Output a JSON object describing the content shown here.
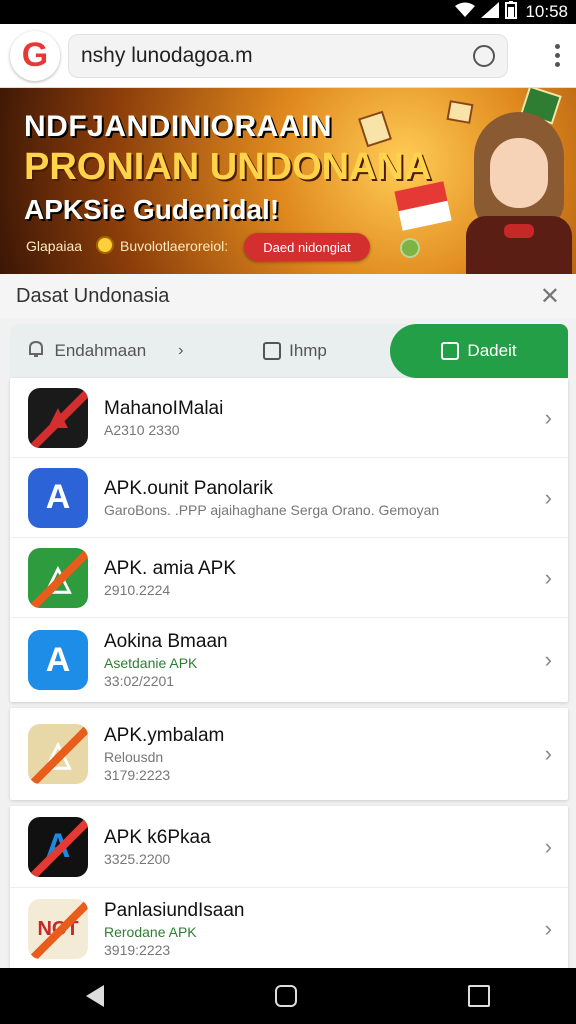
{
  "status_bar": {
    "time": "10:58"
  },
  "url_bar": {
    "logo": "G",
    "url": "nshy lunodagoa.m"
  },
  "banner": {
    "line1": "NDFJANDINIORAAIN",
    "line2": "PRONIAN UNDONANA",
    "line3": "APKSie Gudenidal!",
    "small_left": "Glapaiaa",
    "small_mid": "Buvolotlaeroreiol:",
    "cta_label": "Daed nidongiat"
  },
  "sheet": {
    "title": "Dasat Undonasia"
  },
  "tabs": [
    {
      "label": "Endahmaan",
      "icon": "bell-icon"
    },
    {
      "label": "Ihmp",
      "icon": "box-icon"
    },
    {
      "label": "Dadeit",
      "icon": "bag-icon"
    }
  ],
  "apps": [
    {
      "name": "MahanoIMalai",
      "sub1": "A2310 2330",
      "sub2": "",
      "icon": "app-red-black",
      "color": "#1a1a1a",
      "accent": "#d32f2f"
    },
    {
      "name": "APK.ounit Panolarik",
      "sub1": "GaroBons. .PPP ajaihaghane Serga Orano. Gemoyan",
      "sub2": "",
      "icon": "app-blue-a",
      "color": "#2c63d6",
      "accent": "#ffffff"
    },
    {
      "name": "APK. amia APK",
      "sub1": "2910.2224",
      "sub2": "",
      "icon": "app-green-triangle",
      "color": "#2e9b3e",
      "accent": "#ffffff"
    },
    {
      "name": "Aokina Bmaan",
      "sub1": "Asetdanie APK",
      "sub2": "33:02/2201",
      "icon": "app-azure-a",
      "color": "#1e8de8",
      "accent": "#ffffff"
    },
    {
      "name": "APK.ymbalam",
      "sub1": "Relousdn",
      "sub2": "3179:2223",
      "icon": "app-beige-triangle",
      "color": "#e8d8a8",
      "accent": "#2e7d32"
    },
    {
      "name": "APK k6Pkaa",
      "sub1": "3325.2200",
      "sub2": "",
      "icon": "app-black-a",
      "color": "#111111",
      "accent": "#1e88e5"
    },
    {
      "name": "PanlasiundIsaan",
      "sub1": "Rerodane APK",
      "sub2": "3919:2223",
      "icon": "app-nct",
      "color": "#f3ebd6",
      "accent": "#2e7d32"
    }
  ]
}
